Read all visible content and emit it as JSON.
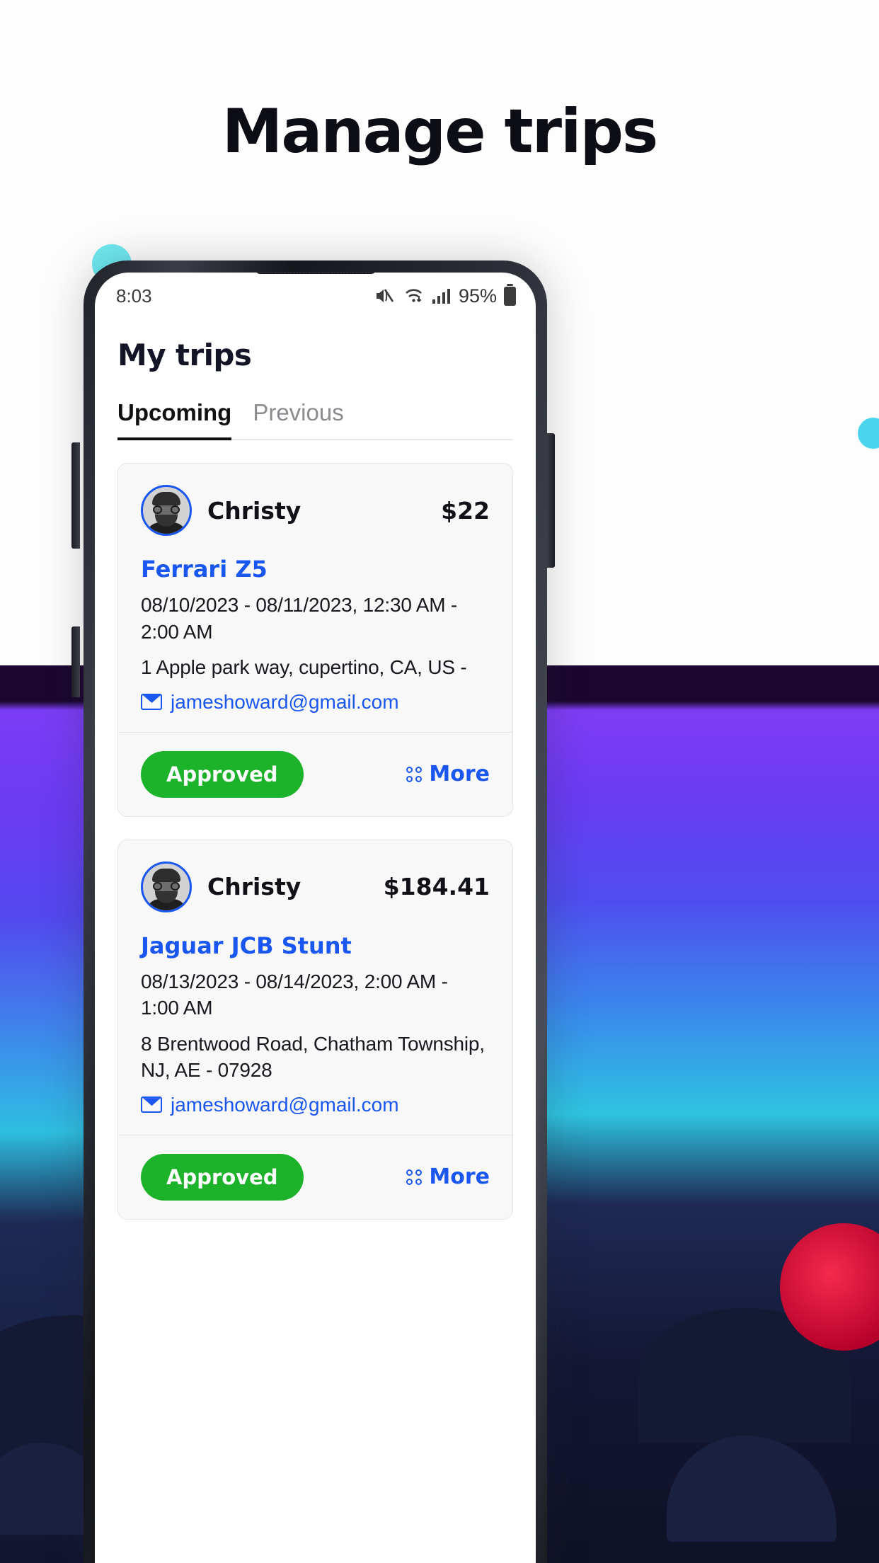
{
  "promo": {
    "headline": "Manage trips"
  },
  "statusbar": {
    "time": "8:03",
    "battery_pct": "95%",
    "icons": [
      "mute-icon",
      "wifi-icon",
      "signal-icon",
      "battery-icon"
    ]
  },
  "app": {
    "title": "My trips",
    "tabs": [
      {
        "label": "Upcoming",
        "active": true
      },
      {
        "label": "Previous",
        "active": false
      }
    ],
    "accent_blue": "#1a56f0",
    "approved_green": "#1cb22a",
    "trips": [
      {
        "owner": "Christy",
        "price": "$22",
        "vehicle": "Ferrari Z5",
        "dates": "08/10/2023 - 08/11/2023, 12:30 AM - 2:00 AM",
        "address": "1 Apple park way, cupertino, CA, US -",
        "email": "jameshoward@gmail.com",
        "status_label": "Approved",
        "more_label": "More"
      },
      {
        "owner": "Christy",
        "price": "$184.41",
        "vehicle": "Jaguar JCB Stunt",
        "dates": "08/13/2023 - 08/14/2023, 2:00 AM - 1:00 AM",
        "address": "8 Brentwood Road, Chatham Township, NJ, AE - 07928",
        "email": "jameshoward@gmail.com",
        "status_label": "Approved",
        "more_label": "More"
      }
    ]
  }
}
